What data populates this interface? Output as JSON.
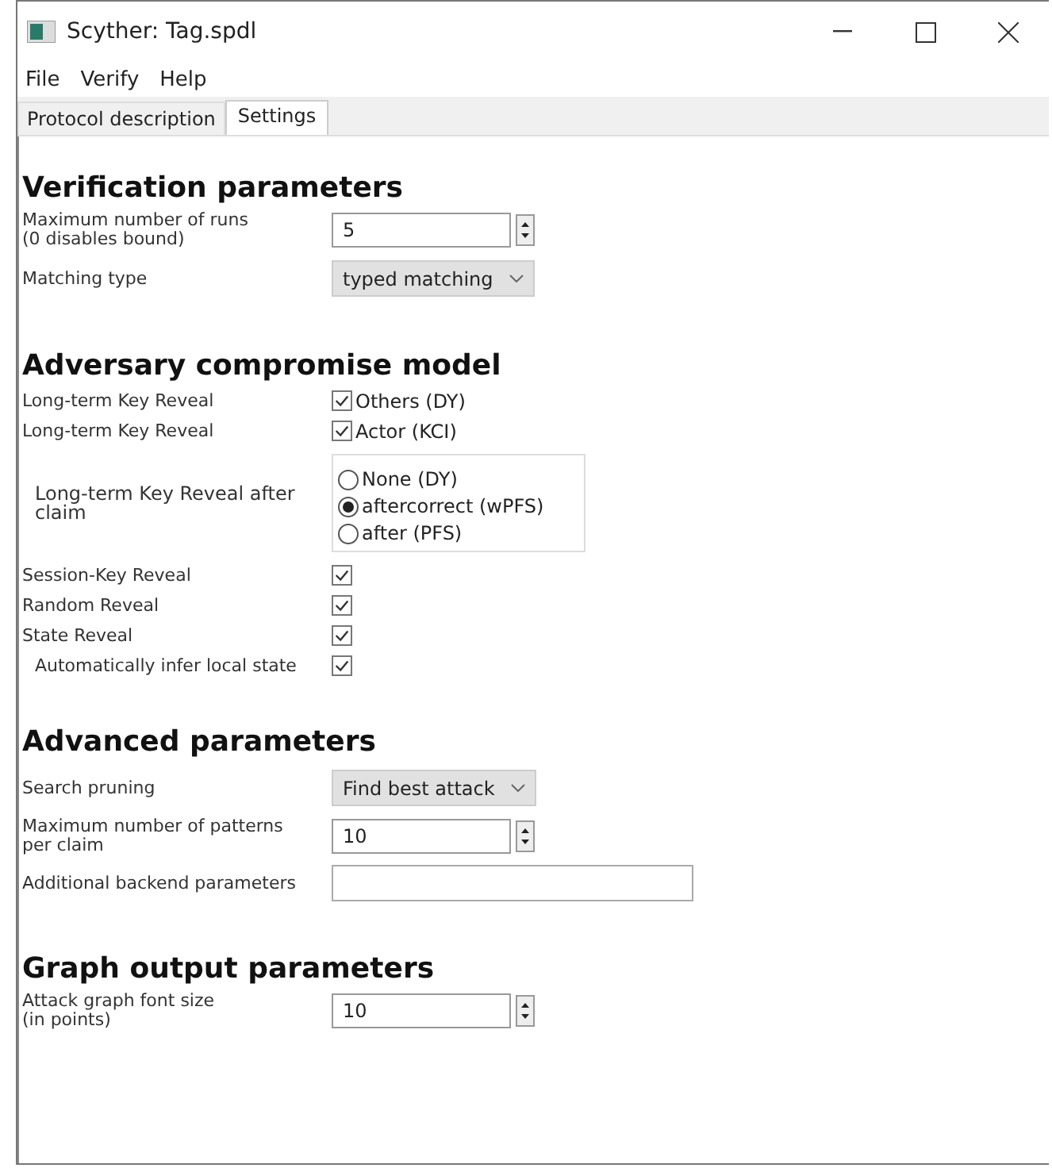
{
  "window": {
    "title": "Scyther: Tag.spdl"
  },
  "menu": [
    "File",
    "Verify",
    "Help"
  ],
  "tabs": [
    {
      "label": "Protocol description",
      "selected": false
    },
    {
      "label": "Settings",
      "selected": true
    }
  ],
  "sections": [
    {
      "title": "Verification parameters",
      "rows": [
        {
          "kind": "spin",
          "label": "Maximum number of runs\n(0 disables bound)",
          "value": "5"
        },
        {
          "kind": "select",
          "label": "Matching type",
          "value": "typed matching"
        }
      ]
    },
    {
      "title": "Adversary compromise model",
      "rows": [
        {
          "kind": "checkbox",
          "label": "Long-term Key Reveal",
          "text": "Others (DY)",
          "checked": true
        },
        {
          "kind": "checkbox",
          "label": "Long-term Key Reveal",
          "text": "Actor (KCI)",
          "checked": true
        },
        {
          "kind": "radio",
          "label": "Long-term Key Reveal after claim",
          "options": [
            {
              "label": "None (DY)",
              "selected": false
            },
            {
              "label": "aftercorrect (wPFS)",
              "selected": true
            },
            {
              "label": "after (PFS)",
              "selected": false
            }
          ]
        },
        {
          "kind": "checkbox",
          "label": "Session-Key Reveal",
          "checked": true
        },
        {
          "kind": "checkbox",
          "label": "Random Reveal",
          "checked": true
        },
        {
          "kind": "checkbox",
          "label": "State Reveal",
          "checked": true
        },
        {
          "kind": "subcheckbox",
          "label": "Automatically infer local state",
          "checked": true
        }
      ]
    },
    {
      "title": "Advanced parameters",
      "rows": [
        {
          "kind": "select",
          "label": "Search pruning",
          "value": "Find best attack"
        },
        {
          "kind": "spin",
          "label": "Maximum number of patterns\nper claim",
          "value": "10"
        },
        {
          "kind": "text",
          "label": "Additional backend parameters"
        }
      ]
    },
    {
      "title": "Graph output parameters",
      "rows": [
        {
          "kind": "spin",
          "label": "Attack graph font size\n(in points)",
          "value": "10"
        }
      ]
    }
  ]
}
